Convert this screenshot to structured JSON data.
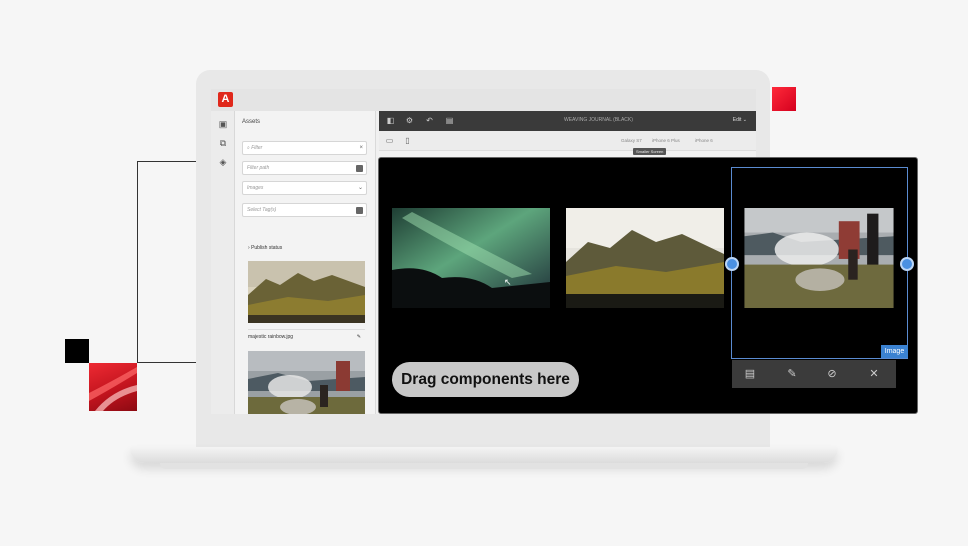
{
  "assets_panel": {
    "title": "Assets",
    "filter_placeholder": "Filter",
    "filter_close": "×",
    "path_placeholder": "Filter path",
    "type_placeholder": "Images",
    "tags_placeholder": "Select Tag(s)",
    "publish_status": "Publish status",
    "asset_1_name": "majestic rainbow.jpg"
  },
  "editor": {
    "doc_title": "WEAVING JOURNAL (BLACK)",
    "mode": "Edit",
    "devices": [
      "Galaxy S7",
      "iPhone 6 Plus",
      "iPhone 6"
    ],
    "smaller_screen": "Smaller Screen"
  },
  "overlay": {
    "drag_label": "Drag components here",
    "selected_badge": "Image"
  },
  "icons": {
    "app_logo": "adobe-logo",
    "toolbar_close": "close-icon"
  },
  "colors": {
    "accent_red": "#e0281b",
    "selection_blue": "#4a90e2"
  }
}
